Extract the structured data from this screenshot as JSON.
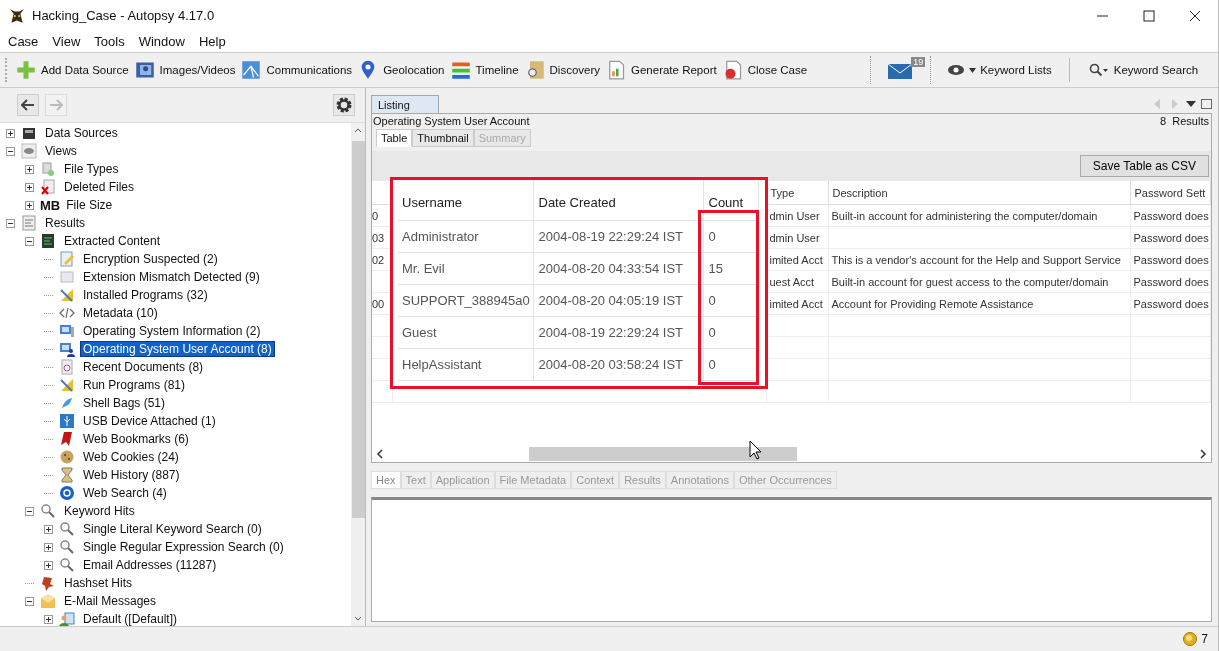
{
  "window": {
    "title": "Hacking_Case - Autopsy 4.17.0"
  },
  "menu": [
    "Case",
    "View",
    "Tools",
    "Window",
    "Help"
  ],
  "toolbar": [
    {
      "label": "Add Data Source"
    },
    {
      "label": "Images/Videos"
    },
    {
      "label": "Communications"
    },
    {
      "label": "Geolocation"
    },
    {
      "label": "Timeline"
    },
    {
      "label": "Discovery"
    },
    {
      "label": "Generate Report"
    },
    {
      "label": "Close Case"
    }
  ],
  "notifications": {
    "count": "19"
  },
  "keyword_lists": {
    "label": "Keyword Lists"
  },
  "keyword_search": {
    "label": "Keyword Search"
  },
  "nav": {
    "back": {
      "disabled": false
    },
    "forward": {
      "disabled": true
    }
  },
  "tree": [
    {
      "label": "Data Sources",
      "expanded": false,
      "selected": false
    },
    {
      "label": "Views",
      "expanded": true,
      "selected": false,
      "children": [
        {
          "label": "File Types",
          "expanded": false,
          "selected": false
        },
        {
          "label": "Deleted Files",
          "expanded": false,
          "selected": false
        },
        {
          "label": "File Size",
          "badge": "MB",
          "expanded": false,
          "selected": false
        }
      ]
    },
    {
      "label": "Results",
      "expanded": true,
      "selected": false,
      "children": [
        {
          "label": "Extracted Content",
          "expanded": true,
          "selected": false,
          "children": [
            {
              "label": "Encryption Suspected (2)",
              "selected": false
            },
            {
              "label": "Extension Mismatch Detected (9)",
              "selected": false
            },
            {
              "label": "Installed Programs (32)",
              "selected": false
            },
            {
              "label": "Metadata (10)",
              "selected": false
            },
            {
              "label": "Operating System Information (2)",
              "selected": false
            },
            {
              "label": "Operating System User Account (8)",
              "selected": true
            },
            {
              "label": "Recent Documents (8)",
              "selected": false
            },
            {
              "label": "Run Programs (81)",
              "selected": false
            },
            {
              "label": "Shell Bags (51)",
              "selected": false
            },
            {
              "label": "USB Device Attached (1)",
              "selected": false
            },
            {
              "label": "Web Bookmarks (6)",
              "selected": false
            },
            {
              "label": "Web Cookies (24)",
              "selected": false
            },
            {
              "label": "Web History (887)",
              "selected": false
            },
            {
              "label": "Web Search (4)",
              "selected": false
            }
          ]
        },
        {
          "label": "Keyword Hits",
          "expanded": true,
          "selected": false,
          "children": [
            {
              "label": "Single Literal Keyword Search (0)",
              "expanded": false,
              "selected": false
            },
            {
              "label": "Single Regular Expression Search (0)",
              "expanded": false,
              "selected": false
            },
            {
              "label": "Email Addresses (11287)",
              "expanded": false,
              "selected": false
            }
          ]
        },
        {
          "label": "Hashset Hits",
          "selected": false
        },
        {
          "label": "E-Mail Messages",
          "expanded": true,
          "selected": false,
          "children": [
            {
              "label": "Default ([Default])",
              "expanded": false,
              "selected": false
            }
          ]
        }
      ]
    }
  ],
  "listing": {
    "tab": "Listing",
    "title": "Operating System User Account",
    "results": "8  Results"
  },
  "view_tabs": [
    {
      "label": "Table",
      "selected": true,
      "disabled": false
    },
    {
      "label": "Thumbnail",
      "selected": false,
      "disabled": false
    },
    {
      "label": "Summary",
      "selected": false,
      "disabled": true
    }
  ],
  "save_button": "Save Table as CSV",
  "table": {
    "columns": [
      "Type",
      "Description",
      "Password Sett"
    ],
    "rows": [
      {
        "column_1": "0",
        "type": "dmin User",
        "description": "Built-in account for administering the computer/domain",
        "password_settings": "Password does"
      },
      {
        "column_1": "03",
        "type": "dmin User",
        "password_settings": "Password does"
      },
      {
        "column_1": "02",
        "type": "imited Acct",
        "description": "This is a vendor's account for the Help and Support Service",
        "password_settings": "Password does"
      },
      {
        "type": "uest Acct",
        "description": "Built-in account for guest access to the computer/domain",
        "password_settings": "Password does"
      },
      {
        "column_1": "00",
        "type": "imited Acct",
        "description": "Account for Providing Remote Assistance",
        "password_settings": "Password does"
      }
    ]
  },
  "callout": {
    "columns": [
      "Username",
      "Date Created",
      "Count"
    ],
    "rows": [
      [
        "Administrator",
        "2004-08-19 22:29:24 IST",
        "0"
      ],
      [
        "Mr. Evil",
        "2004-08-20 04:33:54 IST",
        "15"
      ],
      [
        "SUPPORT_388945a0",
        "2004-08-20 04:05:19 IST",
        "0"
      ],
      [
        "Guest",
        "2004-08-19 22:29:24 IST",
        "0"
      ],
      [
        "HelpAssistant",
        "2004-08-20 03:58:24 IST",
        "0"
      ]
    ]
  },
  "detail_tabs": [
    {
      "label": "Hex",
      "selected": true
    },
    {
      "label": "Text",
      "selected": false
    },
    {
      "label": "Application",
      "selected": false
    },
    {
      "label": "File Metadata",
      "selected": false
    },
    {
      "label": "Context",
      "selected": false
    },
    {
      "label": "Results",
      "selected": false
    },
    {
      "label": "Annotations",
      "selected": false
    },
    {
      "label": "Other Occurrences",
      "selected": false
    }
  ],
  "status_bar": {
    "count": "7"
  }
}
